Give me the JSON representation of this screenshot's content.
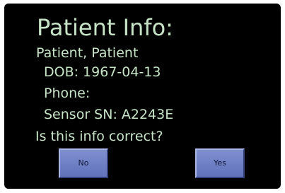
{
  "screen": {
    "title": "Patient Info:",
    "patient_name": "Patient, Patient",
    "dob": "DOB: 1967-04-13",
    "phone": "Phone:",
    "sensor_sn": "Sensor SN: A2243E",
    "question": "Is this info correct?"
  },
  "buttons": {
    "no_label": "No",
    "yes_label": "Yes"
  },
  "colors": {
    "background": "#000000",
    "text": "#c7e3c7",
    "button": "#6f80c5"
  }
}
